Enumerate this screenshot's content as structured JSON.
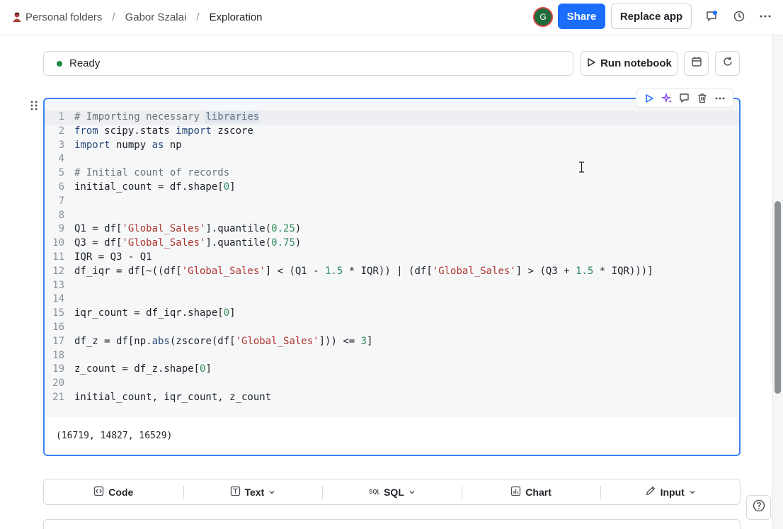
{
  "breadcrumb": {
    "items": [
      "Personal folders",
      "Gabor Szalai",
      "Exploration"
    ],
    "separator": "/"
  },
  "header": {
    "avatar_initial": "G",
    "share_label": "Share",
    "replace_label": "Replace app"
  },
  "notebook": {
    "status": "Ready",
    "run_label": "Run notebook"
  },
  "cell": {
    "lines": [
      "# Importing necessary libraries",
      "from scipy.stats import zscore",
      "import numpy as np",
      "",
      "# Initial count of records",
      "initial_count = df.shape[0]",
      "",
      "",
      "Q1 = df['Global_Sales'].quantile(0.25)",
      "Q3 = df['Global_Sales'].quantile(0.75)",
      "IQR = Q3 - Q1",
      "df_iqr = df[~((df['Global_Sales'] < (Q1 - 1.5 * IQR)) | (df['Global_Sales'] > (Q3 + 1.5 * IQR)))]",
      "",
      "",
      "iqr_count = df_iqr.shape[0]",
      "",
      "df_z = df[np.abs(zscore(df['Global_Sales'])) <= 3]",
      "",
      "z_count = df_z.shape[0]",
      "",
      "initial_count, iqr_count, z_count"
    ],
    "output": "(16719, 14827, 16529)"
  },
  "add_cell": {
    "code": "Code",
    "text": "Text",
    "sql": "SQL",
    "chart": "Chart",
    "input": "Input"
  },
  "colors": {
    "accent": "#1a6dff",
    "cell_border": "#3b82f6",
    "status_ok": "#1e8a47"
  }
}
